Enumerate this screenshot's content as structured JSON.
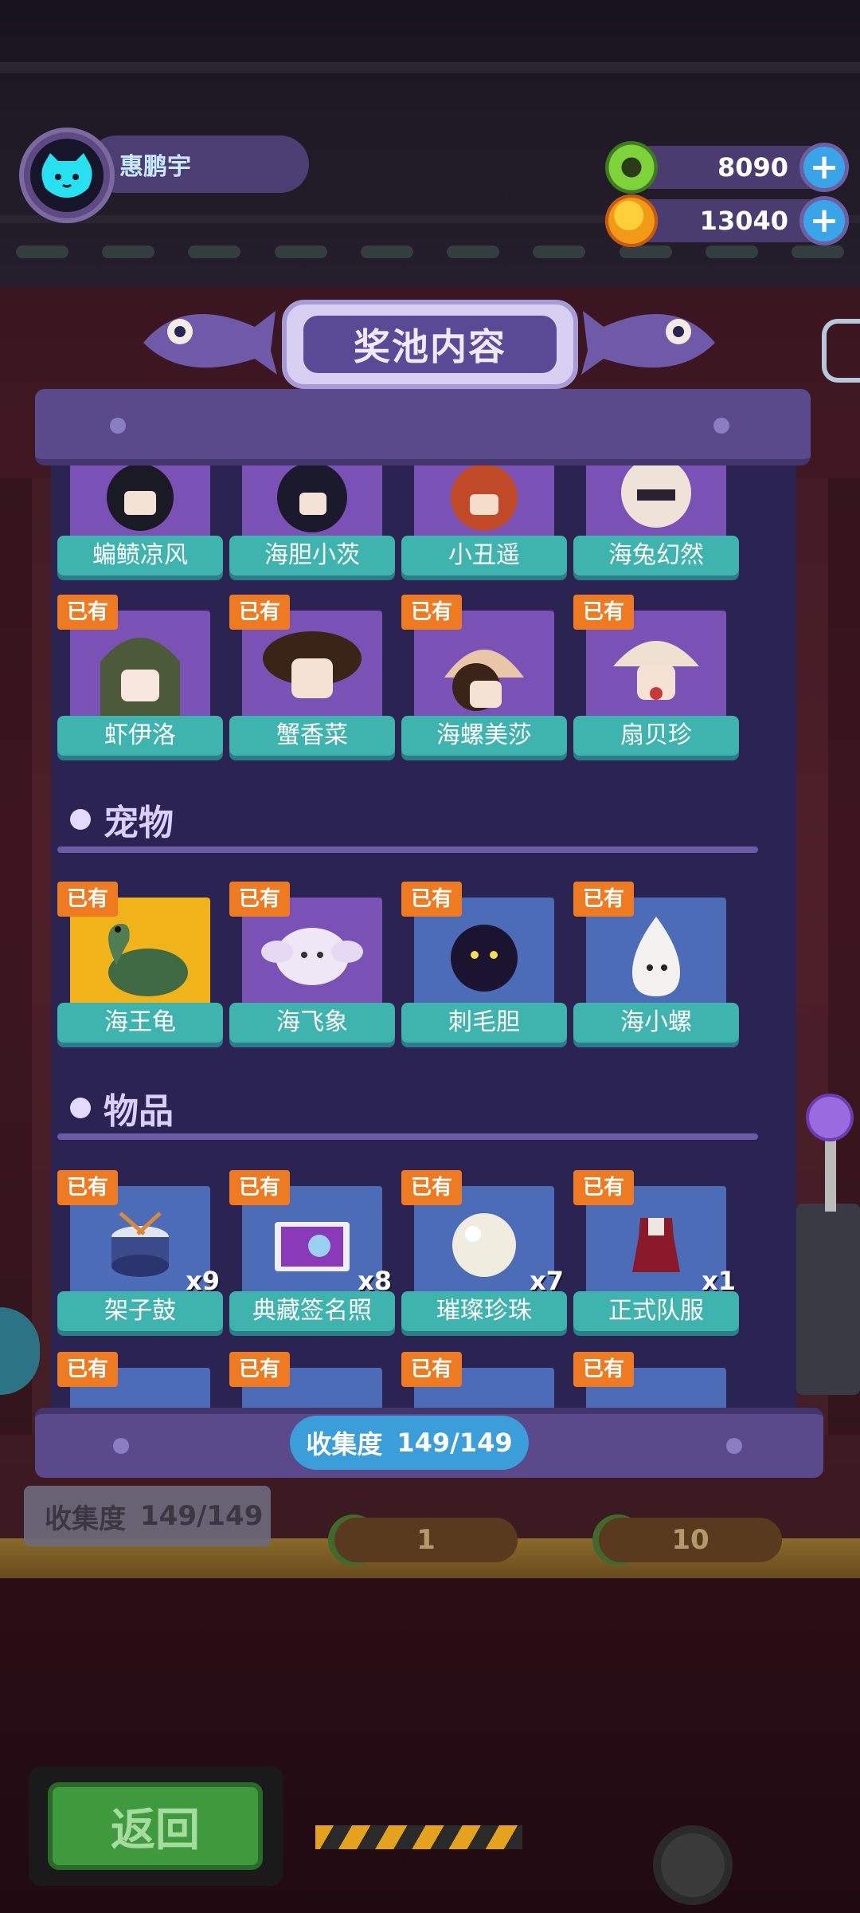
{
  "header": {
    "player_name": "惠鹏宇",
    "currencies": [
      {
        "icon": "green-donut-coin-icon",
        "value": "8090",
        "add_label": "+"
      },
      {
        "icon": "orange-planet-coin-icon",
        "value": "13040",
        "add_label": "+"
      }
    ]
  },
  "popup": {
    "title": "奖池内容",
    "owned_badge": "已有",
    "sections": [
      {
        "heading": "",
        "rows": [
          [
            {
              "name": "蝙鲼凉风",
              "bg": "purple"
            },
            {
              "name": "海胆小茨",
              "bg": "purple"
            },
            {
              "name": "小丑遥",
              "bg": "purple"
            },
            {
              "name": "海兔幻然",
              "bg": "purple"
            }
          ],
          [
            {
              "name": "虾伊洛",
              "bg": "purple",
              "owned": true
            },
            {
              "name": "蟹香菜",
              "bg": "purple",
              "owned": true
            },
            {
              "name": "海螺美莎",
              "bg": "purple",
              "owned": true
            },
            {
              "name": "扇贝珍",
              "bg": "purple",
              "owned": true
            }
          ]
        ]
      },
      {
        "heading": "宠物",
        "rows": [
          [
            {
              "name": "海王龟",
              "bg": "gold",
              "owned": true
            },
            {
              "name": "海飞象",
              "bg": "purple",
              "owned": true
            },
            {
              "name": "刺毛胆",
              "bg": "blue",
              "owned": true
            },
            {
              "name": "海小螺",
              "bg": "blue",
              "owned": true
            }
          ]
        ]
      },
      {
        "heading": "物品",
        "rows": [
          [
            {
              "name": "架子鼓",
              "bg": "blue",
              "owned": true,
              "qty": "x9"
            },
            {
              "name": "典藏签名照",
              "bg": "blue",
              "owned": true,
              "qty": "x8"
            },
            {
              "name": "璀璨珍珠",
              "bg": "blue",
              "owned": true,
              "qty": "x7"
            },
            {
              "name": "正式队服",
              "bg": "blue",
              "owned": true,
              "qty": "x1"
            }
          ]
        ]
      }
    ],
    "collection_label": "收集度",
    "collection_value": "149/149"
  },
  "background": {
    "collection_label": "收集度",
    "collection_value": "149/149",
    "draw_one_count": "1",
    "draw_ten_count": "10",
    "back_button": "返回"
  },
  "colors": {
    "panel": "#2b2452",
    "card_label": "#3fb3ad",
    "badge": "#ee7a22",
    "collect_pill": "#3b9ed8"
  }
}
